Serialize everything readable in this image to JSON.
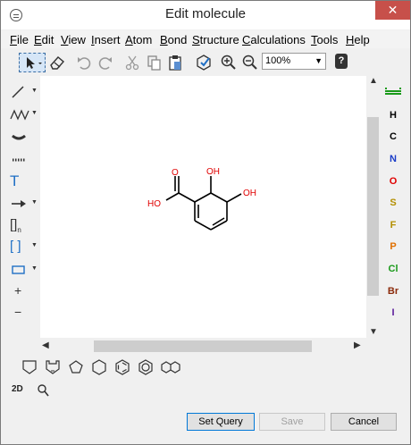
{
  "window": {
    "title": "Edit molecule",
    "close_glyph": "✕"
  },
  "menu": [
    {
      "u": "F",
      "rest": "ile"
    },
    {
      "u": "E",
      "rest": "dit"
    },
    {
      "u": "V",
      "rest": "iew"
    },
    {
      "u": "I",
      "rest": "nsert"
    },
    {
      "u": "A",
      "rest": "tom"
    },
    {
      "u": "B",
      "rest": "ond"
    },
    {
      "u": "S",
      "rest": "tructure"
    },
    {
      "u": "C",
      "rest": "alculations"
    },
    {
      "u": "T",
      "rest": "ools"
    },
    {
      "u": "H",
      "rest": "elp"
    }
  ],
  "toolbar": {
    "zoom": "100%",
    "help_glyph": "?"
  },
  "left_tools": {
    "text_tool": "T",
    "bracket_n": "[]",
    "bracket_n_sub": "n",
    "brackets": "[ ]",
    "charge_plus": "+",
    "charge_minus": "−"
  },
  "molecule": {
    "labels": [
      {
        "text": "O",
        "color": "#e00000"
      },
      {
        "text": "OH",
        "color": "#e00000"
      },
      {
        "text": "OH",
        "color": "#e00000"
      },
      {
        "text": "HO",
        "color": "#e00000"
      }
    ]
  },
  "elements": [
    {
      "symbol": "H",
      "color": "#000000"
    },
    {
      "symbol": "C",
      "color": "#000000"
    },
    {
      "symbol": "N",
      "color": "#1a3cc8"
    },
    {
      "symbol": "O",
      "color": "#e00000"
    },
    {
      "symbol": "S",
      "color": "#b38f00"
    },
    {
      "symbol": "F",
      "color": "#b38f00"
    },
    {
      "symbol": "P",
      "color": "#e07000"
    },
    {
      "symbol": "Cl",
      "color": "#1a9a1a"
    },
    {
      "symbol": "Br",
      "color": "#8b2a0a"
    },
    {
      "symbol": "I",
      "color": "#5a1a9a"
    }
  ],
  "bottom_tools": {
    "two_d": "2D"
  },
  "buttons": {
    "set_query": "Set Query",
    "save": "Save",
    "cancel": "Cancel"
  }
}
